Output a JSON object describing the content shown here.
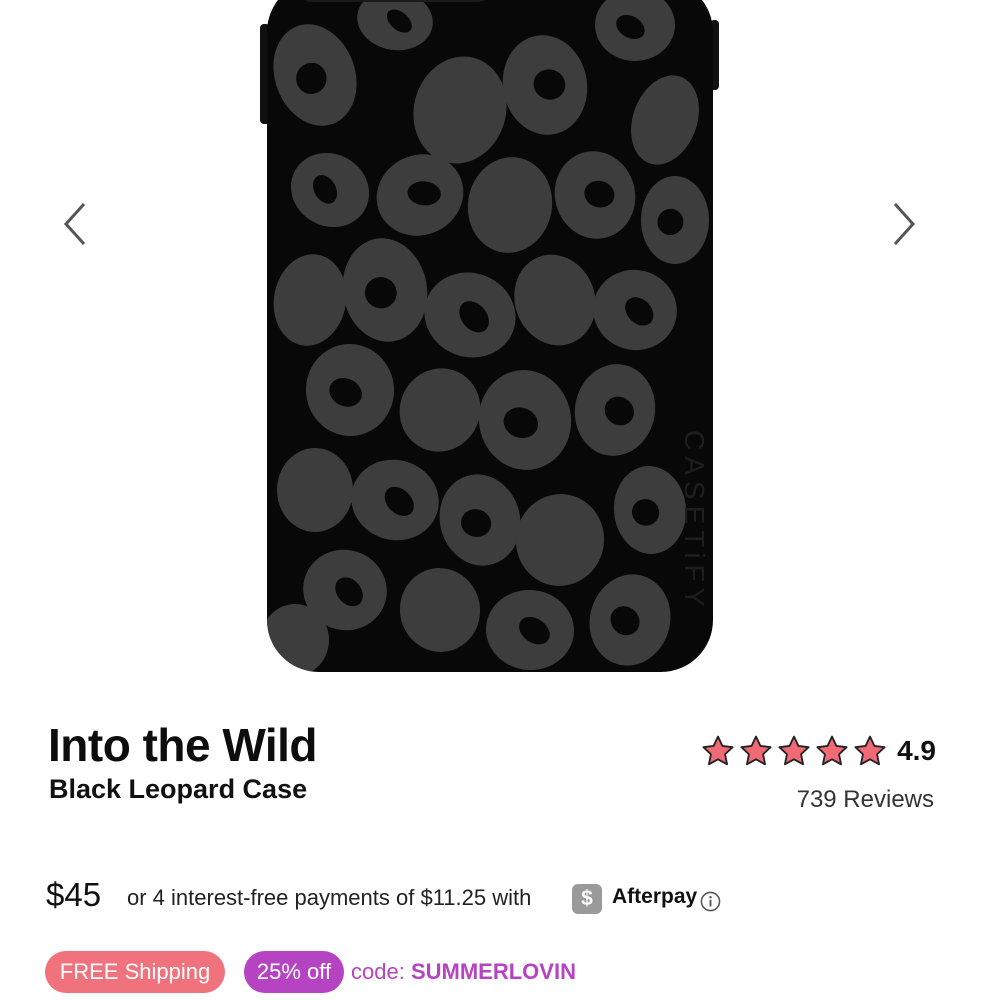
{
  "product": {
    "title": "Into the Wild",
    "subtitle": "Black Leopard Case",
    "case_color": "#080808",
    "spot_color": "#3d3d3d",
    "side_print": "CASETiFY"
  },
  "gallery": {
    "prev_icon": "chevron-left-icon",
    "next_icon": "chevron-right-icon"
  },
  "rating": {
    "value": "4.9",
    "stars": 5,
    "star_color": "#f06a76",
    "reviews_label": "739 Reviews"
  },
  "pricing": {
    "price": "$45",
    "installments_text": "or 4 interest-free payments of $11.25 with",
    "provider_badge": "$",
    "provider_name": "Afterpay"
  },
  "promos": {
    "shipping_label": "FREE Shipping",
    "shipping_color": "#f0727d",
    "discount_label": "25% off",
    "discount_color": "#b543c2",
    "code_prefix": "code:",
    "code_value": "SUMMERLOVIN"
  }
}
